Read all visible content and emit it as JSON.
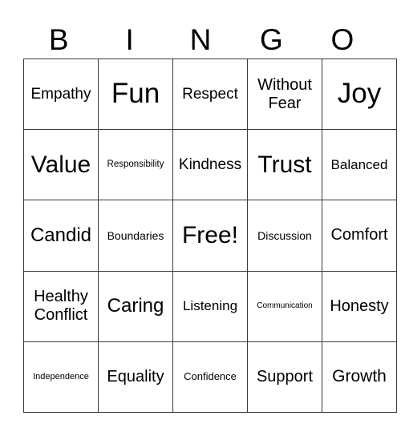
{
  "header": {
    "letters": [
      "B",
      "I",
      "N",
      "G",
      "O"
    ]
  },
  "grid": {
    "rows": [
      [
        "Empathy",
        "Fun",
        "Respect",
        "Without Fear",
        "Joy"
      ],
      [
        "Value",
        "Responsibility",
        "Kindness",
        "Trust",
        "Balanced"
      ],
      [
        "Candid",
        "Boundaries",
        "Free!",
        "Discussion",
        "Comfort"
      ],
      [
        "Healthy Conflict",
        "Caring",
        "Listening",
        "Communication",
        "Honesty"
      ],
      [
        "Independence",
        "Equality",
        "Confidence",
        "Support",
        "Growth"
      ]
    ]
  }
}
